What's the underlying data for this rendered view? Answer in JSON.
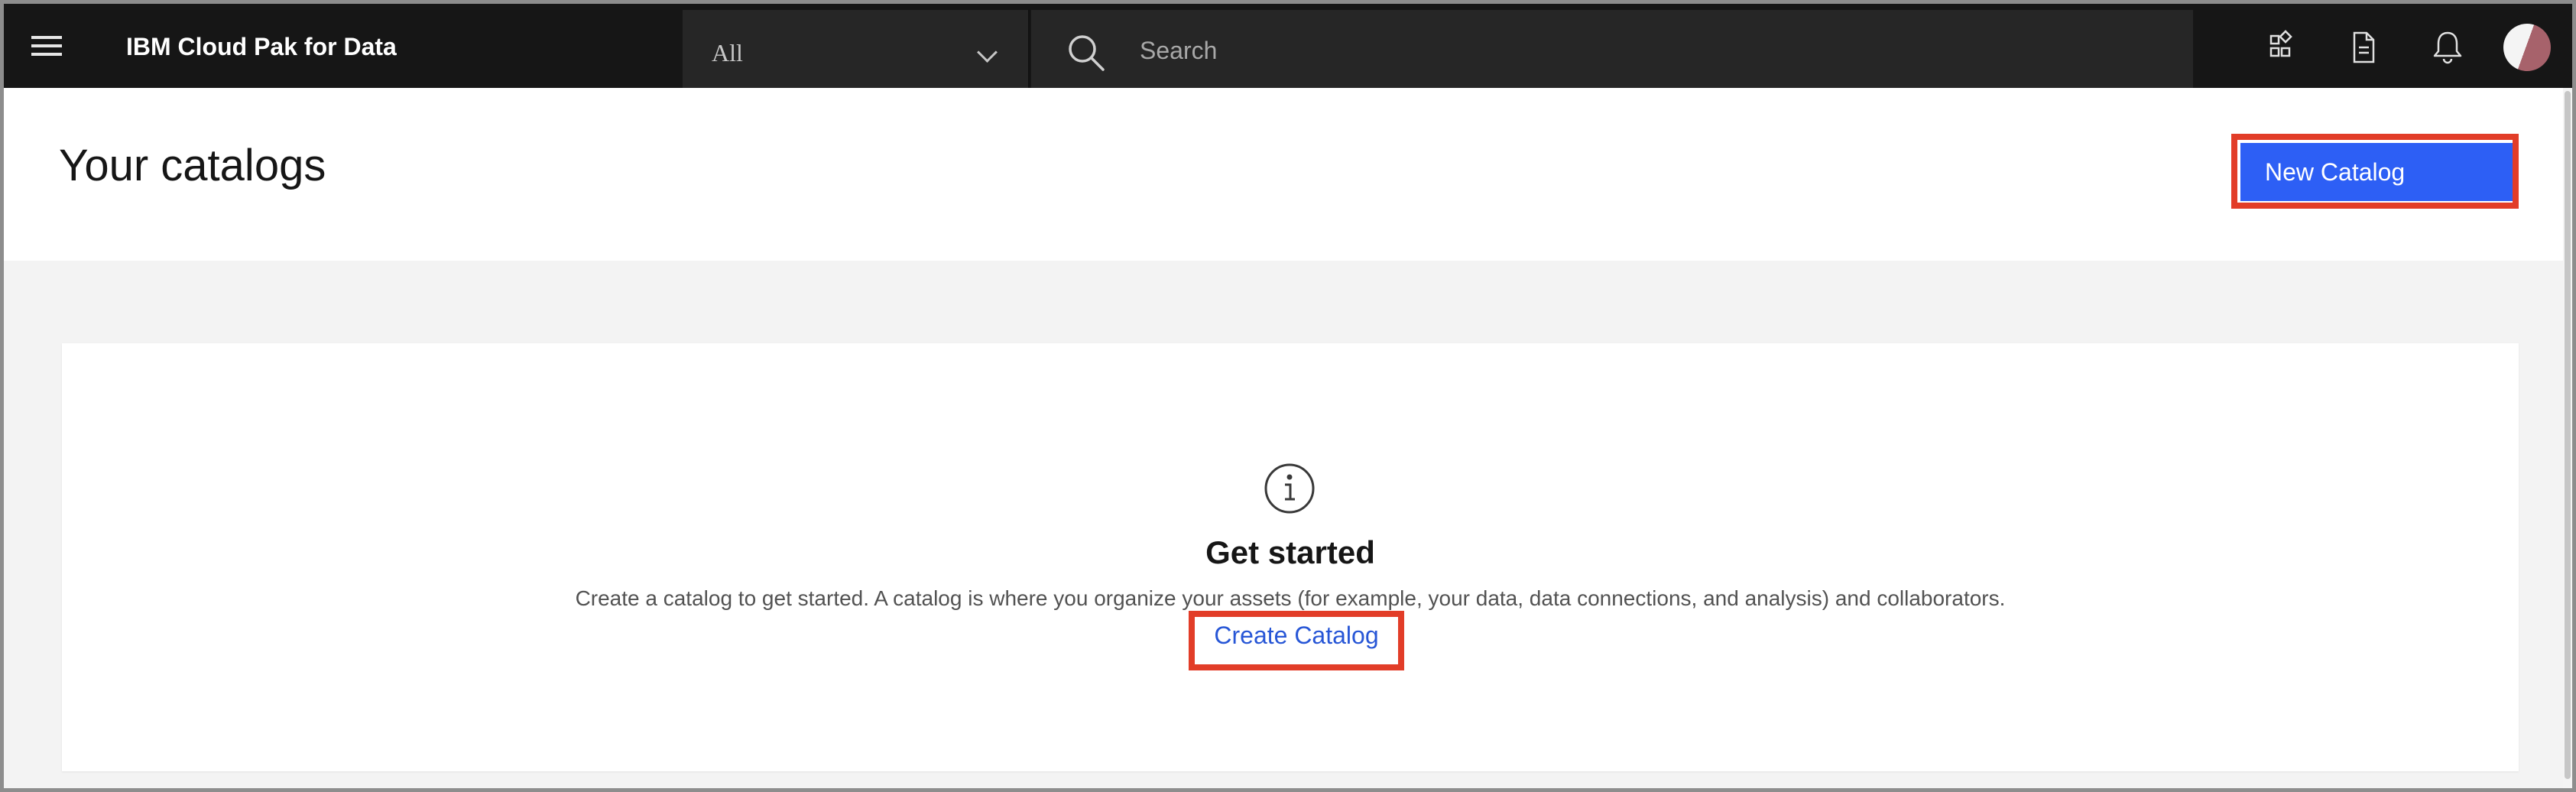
{
  "header": {
    "brand": "IBM Cloud Pak for Data",
    "scope_value": "All",
    "search_placeholder": "Search",
    "icons": [
      "menu-icon",
      "app-switcher-icon",
      "document-icon",
      "notification-icon"
    ]
  },
  "page": {
    "title": "Your catalogs",
    "new_catalog_label": "New Catalog"
  },
  "empty_state": {
    "icon": "info-icon",
    "heading": "Get started",
    "description": "Create a catalog to get started. A catalog is where you organize your assets (for example, your data, data connections, and analysis) and collaborators.",
    "link_label": "Create Catalog"
  },
  "colors": {
    "header_bg": "#161616",
    "primary_button": "#2d5ff5",
    "link": "#2756d6",
    "highlight_outline": "#e23d28",
    "page_bg": "#f3f3f3"
  }
}
